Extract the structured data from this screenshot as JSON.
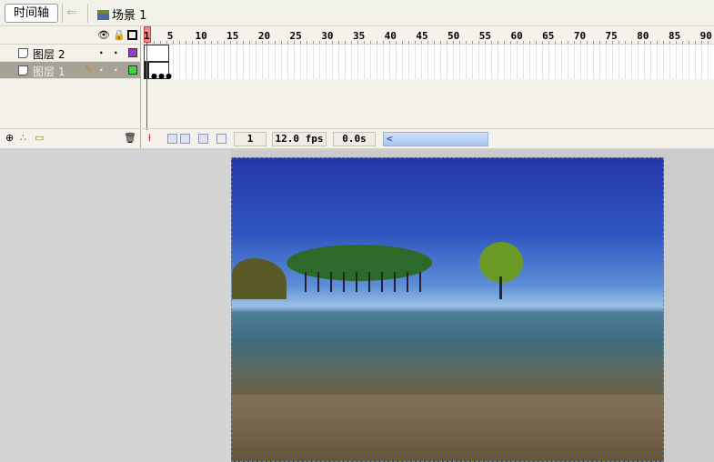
{
  "topbar": {
    "timeline_label": "时间轴",
    "scene_label": "场景 1"
  },
  "layers": [
    {
      "name": "图层 2",
      "color": "#9b3bc9",
      "selected": false
    },
    {
      "name": "图层 1",
      "color": "#33dd33",
      "selected": true
    }
  ],
  "ruler": {
    "labels": [
      "1",
      "5",
      "10",
      "15",
      "20",
      "25",
      "30",
      "35",
      "40",
      "45",
      "50",
      "55",
      "60",
      "65",
      "70",
      "75",
      "80",
      "85",
      "90"
    ]
  },
  "status": {
    "current_frame": "1",
    "frame_rate": "12.0 fps",
    "elapsed_time": "0.0s"
  },
  "icons": {
    "eye": "eye-icon",
    "lock": "lock-icon",
    "outline": "outline-icon",
    "delete": "trash-icon"
  }
}
